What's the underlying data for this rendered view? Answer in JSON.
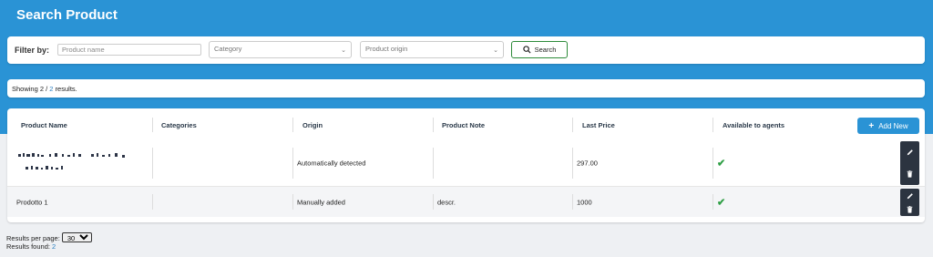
{
  "header": {
    "title": "Search Product"
  },
  "filter": {
    "label": "Filter by:",
    "product_name_placeholder": "Product name",
    "category_placeholder": "Category",
    "origin_placeholder": "Product origin",
    "search_label": "Search"
  },
  "results": {
    "prefix": "Showing 2 /",
    "total": "2",
    "suffix": "results."
  },
  "table": {
    "columns": [
      "Product Name",
      "Categories",
      "Origin",
      "Product Note",
      "Last Price",
      "Available to agents"
    ],
    "add_new_label": "Add New",
    "rows": [
      {
        "name": "",
        "categories": "",
        "origin": "Automatically detected",
        "note": "",
        "price": "297.00",
        "available": true
      },
      {
        "name": "Prodotto 1",
        "categories": "",
        "origin": "Manually added",
        "note": "descr.",
        "price": "1000",
        "available": true
      }
    ]
  },
  "footer": {
    "per_page_label": "Results per page:",
    "per_page_value": "30",
    "found_label": "Results found:",
    "found_value": "2"
  },
  "colors": {
    "primary": "#2a93d5",
    "success": "#2e9e44",
    "action_bg": "#2c3440"
  },
  "icons": [
    "search-icon",
    "plus-icon",
    "check-icon",
    "pencil-icon",
    "trash-icon",
    "chevron-down-icon"
  ]
}
